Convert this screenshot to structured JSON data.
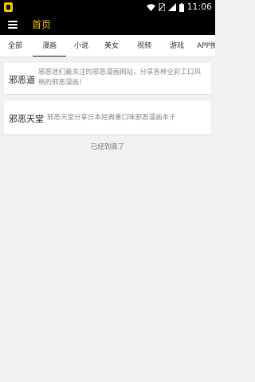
{
  "status_bar": {
    "time": "11:06",
    "icons": [
      "app-icon",
      "wifi-icon",
      "no-sim-icon",
      "signal-icon",
      "battery-icon"
    ]
  },
  "app_bar": {
    "title": "首页",
    "menu_icon": "hamburger-icon"
  },
  "tabs": [
    {
      "label": "全部",
      "active": false
    },
    {
      "label": "漫画",
      "active": true
    },
    {
      "label": "小说",
      "active": false
    },
    {
      "label": "美女",
      "active": false
    },
    {
      "label": "视频",
      "active": false
    },
    {
      "label": "游戏",
      "active": false
    },
    {
      "label": "APP推",
      "active": false
    }
  ],
  "items": [
    {
      "title": "邪恶道",
      "description": "邪恶迷们最关注的邪恶漫画网站，分享各种全彩工口风格的邪恶漫画！"
    },
    {
      "title": "邪恶天堂",
      "description": "邪恶天堂分享日本经典重口味邪恶漫画本子"
    }
  ],
  "end_message": "已经到底了",
  "colors": {
    "title_accent": "#f2c500",
    "bar_bg": "#000000",
    "page_bg": "#f1f1f1"
  }
}
